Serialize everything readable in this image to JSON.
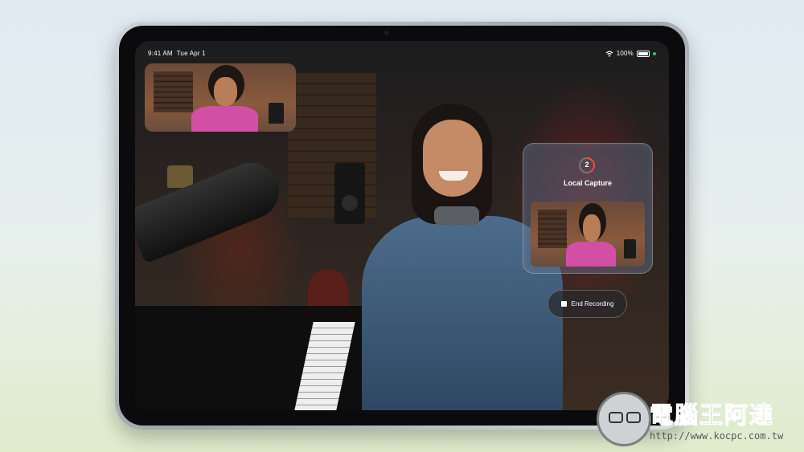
{
  "status_bar": {
    "time": "9:41 AM",
    "date": "Tue Apr 1",
    "battery": "100%"
  },
  "capture": {
    "countdown": "2",
    "title": "Local Capture"
  },
  "controls": {
    "end_recording_label": "End Recording"
  },
  "watermark": {
    "brand": "電腦王阿達",
    "url": "http://www.kocpc.com.tw"
  },
  "colors": {
    "accent_red": "#ff453a",
    "status_green": "#34c759"
  }
}
